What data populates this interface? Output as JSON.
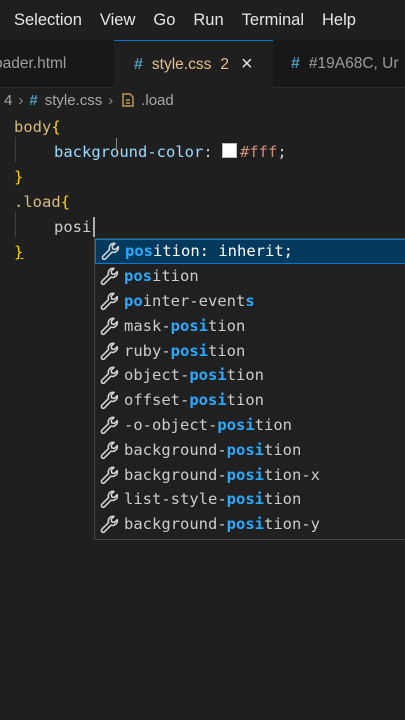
{
  "menubar": {
    "items": [
      "Selection",
      "View",
      "Go",
      "Run",
      "Terminal",
      "Help"
    ]
  },
  "tabs": [
    {
      "label": "oader.html",
      "icon": ""
    },
    {
      "label": "style.css",
      "icon": "#",
      "problems": "2",
      "close": "×"
    },
    {
      "label": "#19A68C, Ur",
      "icon": "#"
    }
  ],
  "breadcrumb": {
    "prefix": "4",
    "sep1": "›",
    "file_icon": "#",
    "file": "style.css",
    "sep2": "›",
    "symbol_icon": "css-rule-icon",
    "symbol": ".load"
  },
  "colors": {
    "accent": "#0078d4",
    "match_highlight": "#2aaaff",
    "selected_row": "#04395e",
    "modified_tab": "#e2c08d"
  },
  "code": {
    "l1_selector": "body",
    "l1_open": "{",
    "l2_prop": "background-color",
    "l2_colon": ": ",
    "l2_value": "#fff",
    "l2_semi": ";",
    "l3_close": "}",
    "l4_selector": ".load",
    "l4_open": "{",
    "l5_typed": "posi",
    "l6_close": "}"
  },
  "suggestions": [
    {
      "icon": "wrench-icon",
      "parts": [
        [
          "pos",
          true
        ],
        [
          "ition: inherit;",
          false
        ]
      ]
    },
    {
      "icon": "wrench-icon",
      "parts": [
        [
          "pos",
          true
        ],
        [
          "ition",
          false
        ]
      ]
    },
    {
      "icon": "wrench-icon",
      "parts": [
        [
          "po",
          true
        ],
        [
          "inter-event",
          false
        ],
        [
          "s",
          true
        ]
      ]
    },
    {
      "icon": "wrench-icon",
      "parts": [
        [
          "mask-",
          false
        ],
        [
          "posi",
          true
        ],
        [
          "tion",
          false
        ]
      ]
    },
    {
      "icon": "wrench-icon",
      "parts": [
        [
          "ruby-",
          false
        ],
        [
          "posi",
          true
        ],
        [
          "tion",
          false
        ]
      ]
    },
    {
      "icon": "wrench-icon",
      "parts": [
        [
          "object-",
          false
        ],
        [
          "posi",
          true
        ],
        [
          "tion",
          false
        ]
      ]
    },
    {
      "icon": "wrench-icon",
      "parts": [
        [
          "offset-",
          false
        ],
        [
          "posi",
          true
        ],
        [
          "tion",
          false
        ]
      ]
    },
    {
      "icon": "wrench-icon",
      "parts": [
        [
          "-o-object-",
          false
        ],
        [
          "posi",
          true
        ],
        [
          "tion",
          false
        ]
      ]
    },
    {
      "icon": "wrench-icon",
      "parts": [
        [
          "background-",
          false
        ],
        [
          "posi",
          true
        ],
        [
          "tion",
          false
        ]
      ]
    },
    {
      "icon": "wrench-icon",
      "parts": [
        [
          "background-",
          false
        ],
        [
          "posi",
          true
        ],
        [
          "tion-x",
          false
        ]
      ]
    },
    {
      "icon": "wrench-icon",
      "parts": [
        [
          "list-style-",
          false
        ],
        [
          "posi",
          true
        ],
        [
          "tion",
          false
        ]
      ]
    },
    {
      "icon": "wrench-icon",
      "parts": [
        [
          "background-",
          false
        ],
        [
          "posi",
          true
        ],
        [
          "tion-y",
          false
        ]
      ]
    }
  ]
}
